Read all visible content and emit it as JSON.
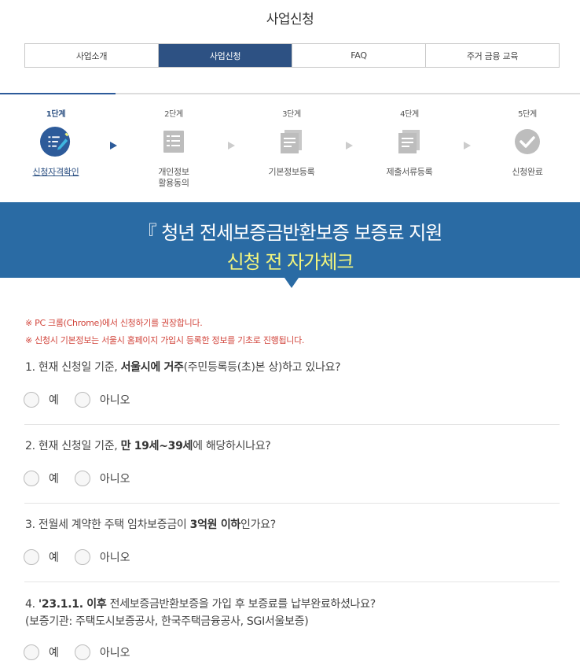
{
  "page": {
    "title": "사업신청"
  },
  "tabs": [
    {
      "label": "사업소개",
      "active": false
    },
    {
      "label": "사업신청",
      "active": true
    },
    {
      "label": "FAQ",
      "active": false
    },
    {
      "label": "주거 금융 교육",
      "active": false
    }
  ],
  "steps": [
    {
      "num": "1단계",
      "label": "신청자격확인",
      "icon": "checklist-pen-icon"
    },
    {
      "num": "2단계",
      "label": "개인정보\n활용동의",
      "icon": "clipboard-icon"
    },
    {
      "num": "3단계",
      "label": "기본정보등록",
      "icon": "document-icon"
    },
    {
      "num": "4단계",
      "label": "제출서류등록",
      "icon": "document-icon"
    },
    {
      "num": "5단계",
      "label": "신청완료",
      "icon": "check-circle-icon"
    }
  ],
  "banner": {
    "line1": "『 청년 전세보증금반환보증 보증료 지원",
    "line2": "신청 전 자가체크"
  },
  "notices": [
    "※ PC 크롬(Chrome)에서 신청하기를 권장합니다.",
    "※ 신청시 기본정보는 서울시 홈페이지 가입시 등록한 정보를 기초로 진행됩니다."
  ],
  "questions": [
    {
      "pre": "1. 현재 신청일 기준, ",
      "bold": "서울시에 거주",
      "post": "(주민등록등(초)본 상)하고 있나요?",
      "line2": ""
    },
    {
      "pre": "2. 현재 신청일 기준, ",
      "bold": "만 19세~39세",
      "post": "에 해당하시나요?",
      "line2": ""
    },
    {
      "pre": "3. 전월세 계약한 주택 임차보증금이 ",
      "bold": "3억원 이하",
      "post": "인가요?",
      "line2": ""
    },
    {
      "pre": "4. ",
      "bold": "'23.1.1. 이후",
      "post": " 전세보증금반환보증을 가입 후 보증료를 납부완료하셨나요?",
      "line2": "(보증기관: 주택도시보증공사, 한국주택금융공사, SGI서울보증)"
    }
  ],
  "options": {
    "yes": "예",
    "no": "아니오"
  },
  "colors": {
    "primary": "#2d5183",
    "banner": "#2a6ba4",
    "highlight": "#f2f57e",
    "notice": "#d2453c"
  }
}
